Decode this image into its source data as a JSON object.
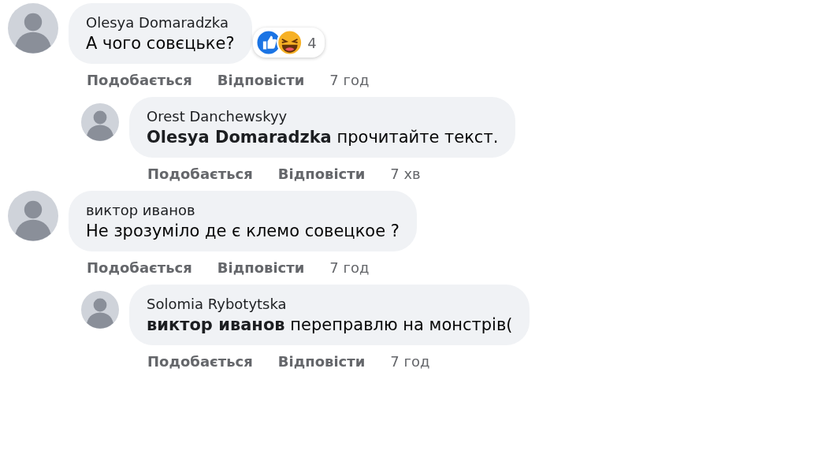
{
  "comments": [
    {
      "author": "Olesya Domaradzka",
      "text": "А чого совєцьке?",
      "reactions": {
        "count": "4"
      },
      "actions": [
        "Подобається",
        "Відповісти"
      ],
      "time": "7 год",
      "replies": [
        {
          "author": "Orest Danchewskyy",
          "mention": "Olesya Domaradzka",
          "text": "прочитайте текст.",
          "actions": [
            "Подобається",
            "Відповісти"
          ],
          "time": "7 хв"
        }
      ]
    },
    {
      "author": "виктор иванов",
      "text": "Не зрозуміло де є клемо совецкое ?",
      "actions": [
        "Подобається",
        "Відповісти"
      ],
      "time": "7 год",
      "replies": [
        {
          "author": "Solomia Rybotytska",
          "mention": "виктор иванов",
          "text": "переправлю на монстрів(",
          "actions": [
            "Подобається",
            "Відповісти"
          ],
          "time": "7 год"
        }
      ]
    }
  ]
}
